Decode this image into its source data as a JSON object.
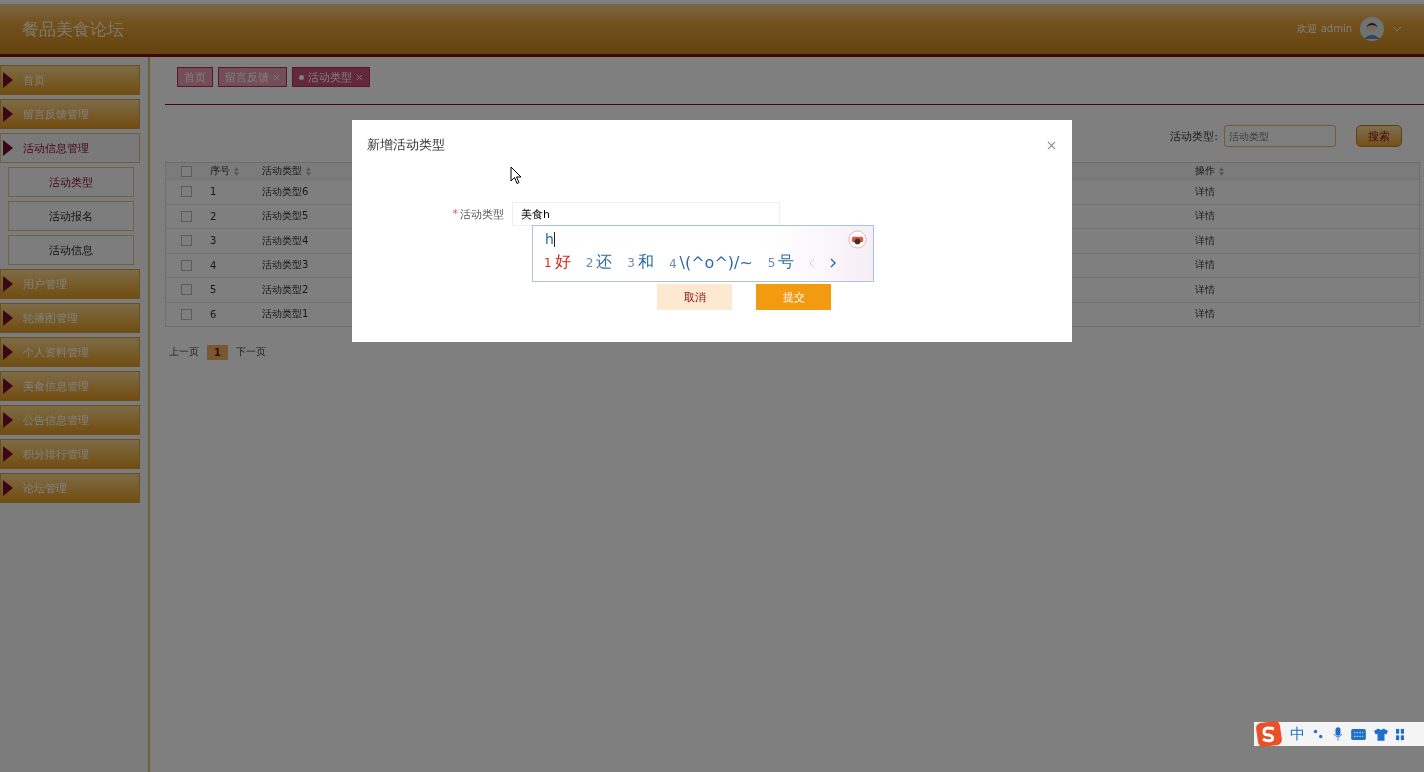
{
  "header": {
    "title": "餐品美食论坛",
    "greeting": "欢迎 admin"
  },
  "sidebar": {
    "items": [
      {
        "label": "首页",
        "expanded": false
      },
      {
        "label": "留言反馈管理",
        "expanded": false
      },
      {
        "label": "活动信息管理",
        "expanded": true,
        "children": [
          {
            "label": "活动类型",
            "selected": true
          },
          {
            "label": "活动报名",
            "selected": false
          },
          {
            "label": "活动信息",
            "selected": false
          }
        ]
      },
      {
        "label": "用户管理",
        "expanded": false
      },
      {
        "label": "轮播图管理",
        "expanded": false
      },
      {
        "label": "个人资料管理",
        "expanded": false
      },
      {
        "label": "美食信息管理",
        "expanded": false
      },
      {
        "label": "公告信息管理",
        "expanded": false
      },
      {
        "label": "积分排行管理",
        "expanded": false
      },
      {
        "label": "论坛管理",
        "expanded": false
      }
    ]
  },
  "breadcrumb_tabs": [
    {
      "label": "首页",
      "closable": false,
      "selected": false
    },
    {
      "label": "留言反馈",
      "closable": true,
      "selected": false
    },
    {
      "label": "活动类型",
      "closable": true,
      "selected": true
    }
  ],
  "search": {
    "label": "活动类型:",
    "placeholder": "活动类型",
    "button": "搜索"
  },
  "table": {
    "select_all_checked": false,
    "columns": [
      "序号",
      "活动类型",
      "操作"
    ],
    "rows": [
      {
        "checked": false,
        "index": "1",
        "type": "活动类型6",
        "action": "详情"
      },
      {
        "checked": false,
        "index": "2",
        "type": "活动类型5",
        "action": "详情"
      },
      {
        "checked": false,
        "index": "3",
        "type": "活动类型4",
        "action": "详情"
      },
      {
        "checked": false,
        "index": "4",
        "type": "活动类型3",
        "action": "详情"
      },
      {
        "checked": false,
        "index": "5",
        "type": "活动类型2",
        "action": "详情"
      },
      {
        "checked": false,
        "index": "6",
        "type": "活动类型1",
        "action": "详情"
      }
    ]
  },
  "pagination": {
    "prev": "上一页",
    "pages": [
      {
        "label": "1",
        "selected": true
      }
    ],
    "next": "下一页"
  },
  "dialog": {
    "title": "新增活动类型",
    "field": {
      "required_mark": "*",
      "label": "活动类型",
      "value": "美食h"
    },
    "buttons": [
      {
        "label": "取消",
        "kind": "cancel"
      },
      {
        "label": "提交",
        "kind": "submit"
      }
    ]
  },
  "ime": {
    "composition": "h",
    "candidates": [
      {
        "number": "1",
        "text": "好",
        "selected": true
      },
      {
        "number": "2",
        "text": "还",
        "selected": false
      },
      {
        "number": "3",
        "text": "和",
        "selected": false
      },
      {
        "number": "4",
        "text": "\\(^o^)/~",
        "selected": false
      },
      {
        "number": "5",
        "text": "号",
        "selected": false
      }
    ],
    "status_label": "中"
  }
}
